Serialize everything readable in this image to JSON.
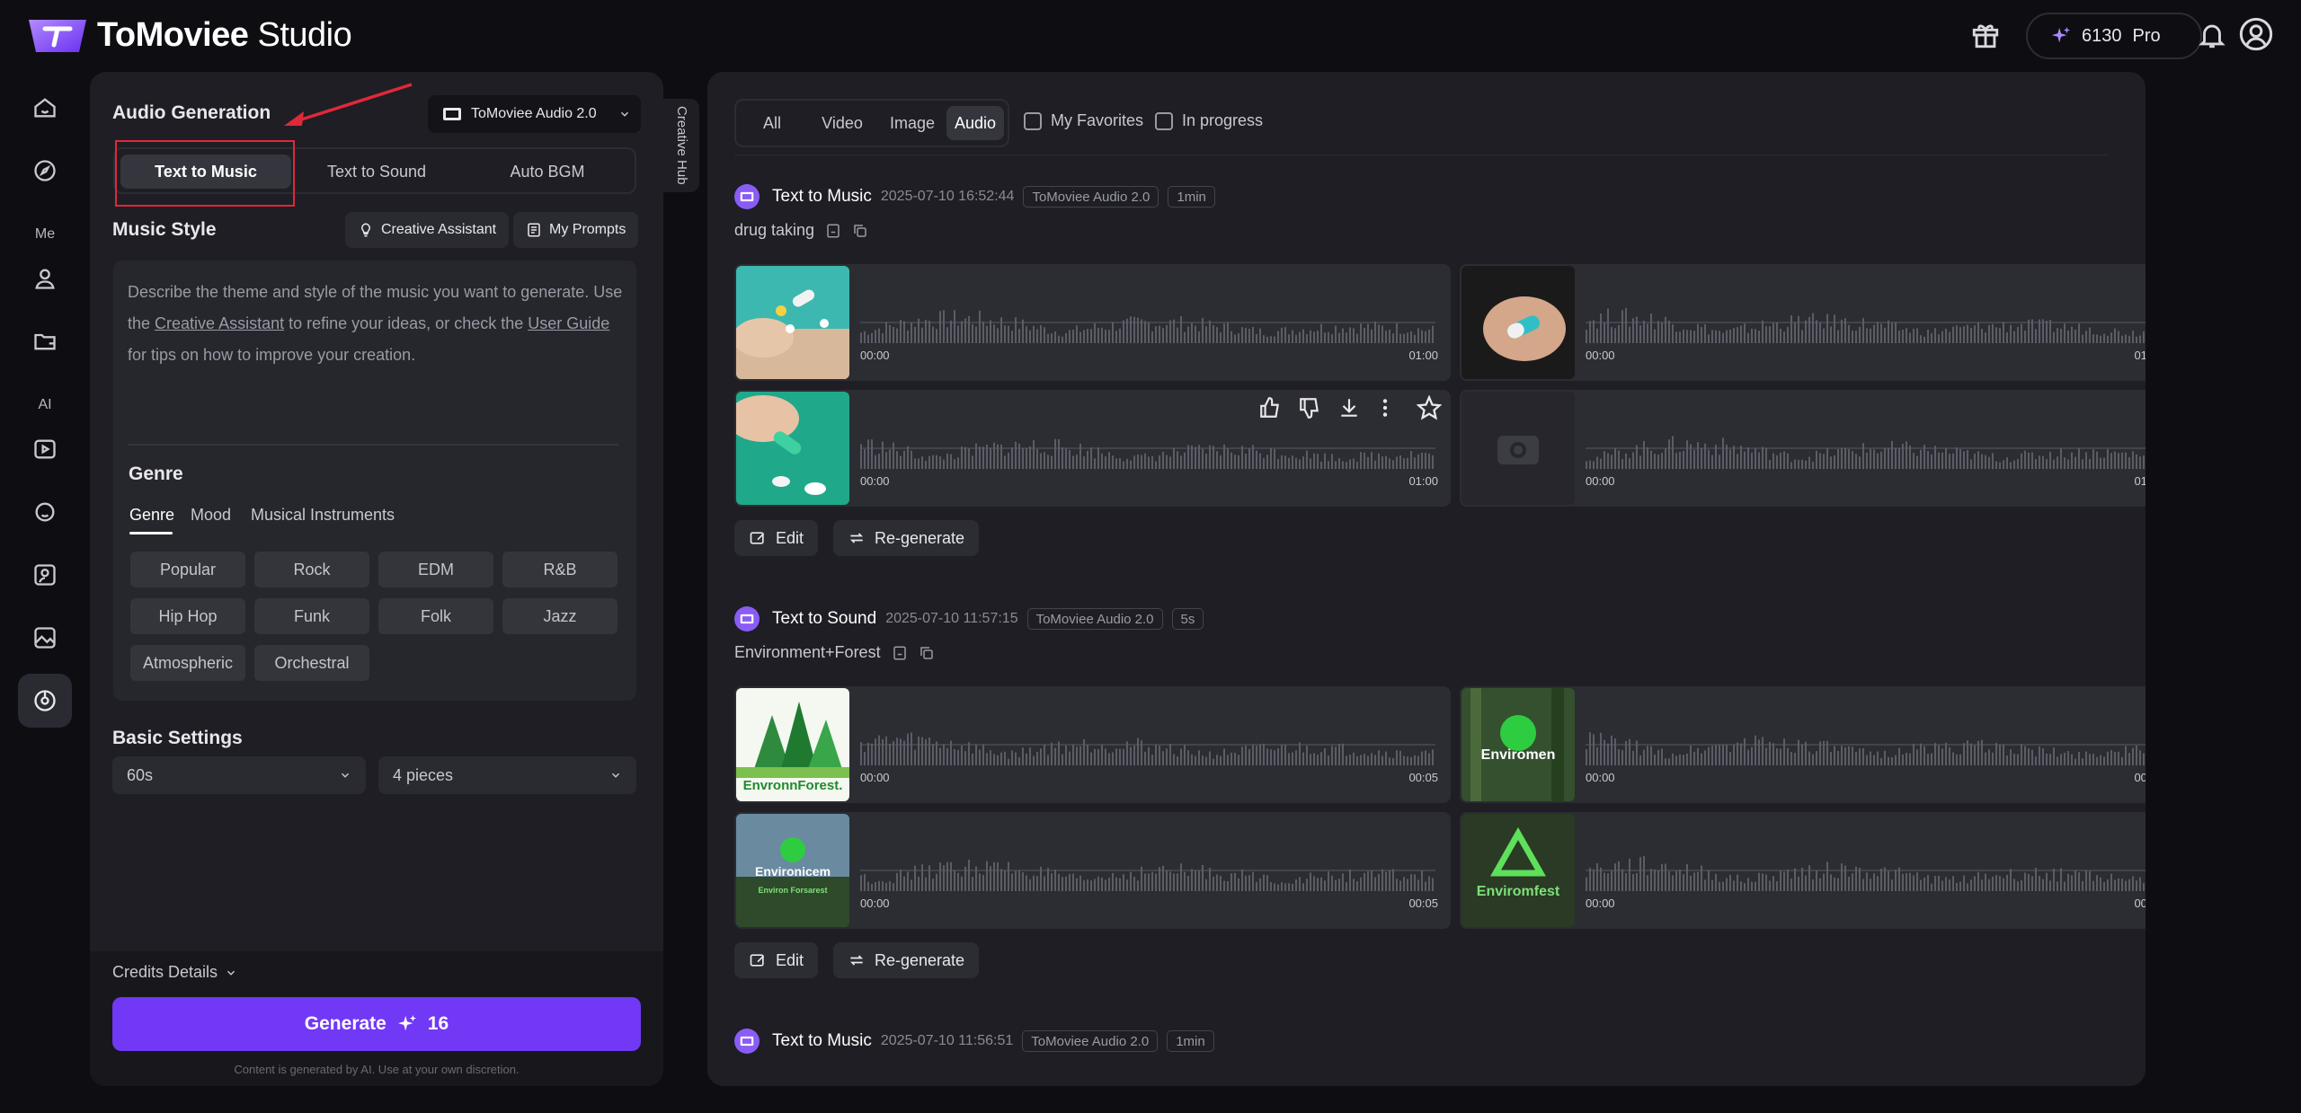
{
  "app": {
    "brand_bold": "ToMoviee",
    "brand_light": "Studio"
  },
  "header": {
    "credits": "6130",
    "plan": "Pro"
  },
  "rail": {
    "label_me": "Me",
    "label_ai": "AI"
  },
  "panel": {
    "title": "Audio Generation",
    "model": "ToMoviee Audio 2.0",
    "tabs": [
      "Text to Music",
      "Text to Sound",
      "Auto BGM"
    ],
    "music_style_title": "Music Style",
    "creative_assistant": "Creative Assistant",
    "my_prompts": "My Prompts",
    "desc_1": "Describe the theme and style of the music you want to generate. Use the ",
    "desc_link1": "Creative Assistant",
    "desc_2": " to refine your ideas, or check the ",
    "desc_link2": "User Guide",
    "desc_3": " for tips on how to improve your creation.",
    "genre_title": "Genre",
    "subtabs": [
      "Genre",
      "Mood",
      "Musical Instruments"
    ],
    "genres": [
      "Popular",
      "Rock",
      "EDM",
      "R&B",
      "Hip Hop",
      "Funk",
      "Folk",
      "Jazz",
      "Atmospheric",
      "Orchestral"
    ],
    "basic_settings_title": "Basic Settings",
    "duration": "60s",
    "pieces": "4 pieces",
    "credits_details": "Credits Details",
    "generate_label": "Generate",
    "generate_cost": "16",
    "disclaimer": "Content is generated by AI. Use at your own discretion."
  },
  "creative_hub": "Creative Hub",
  "filters": {
    "tabs": [
      "All",
      "Video",
      "Image",
      "Audio"
    ],
    "my_favorites": "My Favorites",
    "in_progress": "In progress"
  },
  "groups": [
    {
      "type": "Text to Music",
      "date": "2025-07-10 16:52:44",
      "model": "ToMoviee Audio 2.0",
      "duration_tag": "1min",
      "prompt": "drug taking",
      "start": "00:00",
      "end": "01:00"
    },
    {
      "type": "Text to Sound",
      "date": "2025-07-10 11:57:15",
      "model": "ToMoviee Audio 2.0",
      "duration_tag": "5s",
      "prompt": "Environment+Forest",
      "start": "00:00",
      "end": "00:05",
      "thumb_labels": [
        "EnvronnForest.",
        "Enviromen",
        "Environicem",
        "Enviromfest"
      ],
      "thumb_sub": "Environ Forsarest"
    },
    {
      "type": "Text to Music",
      "date": "2025-07-10 11:56:51",
      "model": "ToMoviee Audio 2.0",
      "duration_tag": "1min"
    }
  ],
  "actions": {
    "edit": "Edit",
    "regenerate": "Re-generate"
  },
  "colors": {
    "accent": "#7138f5",
    "panel": "#1e1e24",
    "card": "#2c2c33",
    "highlight": "#e0283a"
  }
}
